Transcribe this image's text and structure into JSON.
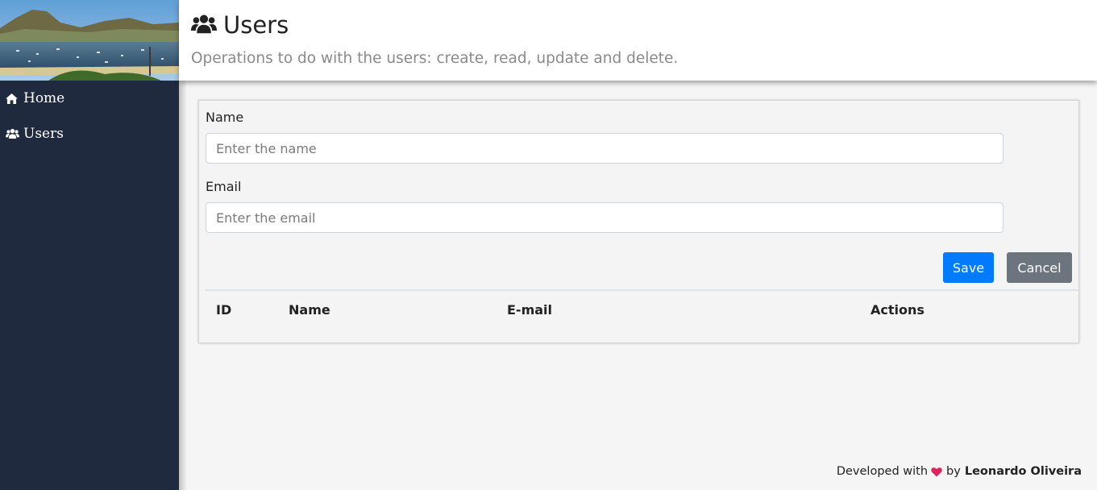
{
  "sidebar": {
    "items": [
      {
        "label": "Home",
        "icon": "home-icon"
      },
      {
        "label": "Users",
        "icon": "users-icon"
      }
    ]
  },
  "header": {
    "title": "Users",
    "title_icon": "users-icon",
    "subtitle": "Operations to do with the users: create, read, update and delete."
  },
  "form": {
    "name_label": "Name",
    "name_placeholder": "Enter the name",
    "name_value": "",
    "email_label": "Email",
    "email_placeholder": "Enter the email",
    "email_value": "",
    "save_label": "Save",
    "cancel_label": "Cancel"
  },
  "table": {
    "columns": [
      "ID",
      "Name",
      "E-mail",
      "Actions"
    ],
    "rows": []
  },
  "footer": {
    "prefix": "Developed with",
    "heart_icon": "heart-icon",
    "by": "by",
    "author": "Leonardo Oliveira"
  },
  "colors": {
    "sidebar_bg": "#1f2a3e",
    "primary": "#007bff",
    "secondary": "#6c757d",
    "heart": "#e0245e"
  }
}
